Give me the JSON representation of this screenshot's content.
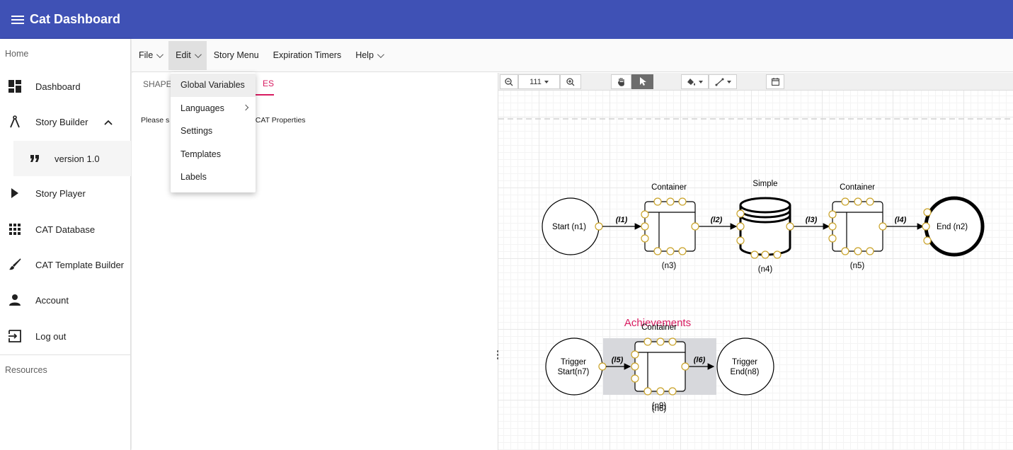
{
  "app": {
    "title": "Cat Dashboard"
  },
  "sidebar": {
    "home_header": "Home",
    "resources_header": "Resources",
    "items": [
      {
        "label": "Dashboard",
        "icon": "dashboard-icon"
      },
      {
        "label": "Story Builder",
        "icon": "compass-icon"
      },
      {
        "label": "version 1.0",
        "icon": "quote-icon"
      },
      {
        "label": "Story Player",
        "icon": "play-icon"
      },
      {
        "label": "CAT Database",
        "icon": "grid-icon"
      },
      {
        "label": "CAT Template Builder",
        "icon": "brush-icon"
      },
      {
        "label": "Account",
        "icon": "person-icon"
      },
      {
        "label": "Log out",
        "icon": "logout-icon"
      }
    ]
  },
  "menubar": {
    "file": "File",
    "edit": "Edit",
    "story_menu": "Story Menu",
    "expiration_timers": "Expiration Timers",
    "help": "Help"
  },
  "edit_menu": {
    "items": [
      "Global Variables",
      "Languages",
      "Settings",
      "Templates",
      "Labels"
    ]
  },
  "left_pane": {
    "tab_shapes": "SHAPES",
    "tab_properties": "ES",
    "message_left": "Please s",
    "message_right": "e CAT Properties"
  },
  "toolbar": {
    "zoom": "111",
    "icons": [
      "zoom-out-icon",
      "zoom-in-icon",
      "pan-hand-icon",
      "pointer-icon",
      "fill-color-icon",
      "line-style-icon",
      "calendar-icon"
    ]
  },
  "diagram": {
    "nodes": {
      "n1": "Start (n1)",
      "n2": "End (n2)",
      "n3_title": "Container",
      "n3_id": "(n3)",
      "n4_title": "Simple",
      "n4_id": "(n4)",
      "n5_title": "Container",
      "n5_id": "(n5)",
      "n7_line1": "Trigger",
      "n7_line2": "Start(n7)",
      "n8_line1": "Trigger",
      "n8_line2": "End(n8)",
      "n9_title": "Container",
      "n9_id": "(n9)",
      "n6_id": "(n6)"
    },
    "edges": {
      "l1": "(l1)",
      "l2": "(l2)",
      "l3": "(l3)",
      "l4": "(l4)",
      "l5": "(l5)",
      "l6": "(l6)"
    },
    "group_label": "Achievements",
    "colors": {
      "port_fill": "#ffffff",
      "port_stroke": "#c9a227",
      "group_fill": "#d7d8dc",
      "group_label": "#d81b60"
    }
  }
}
